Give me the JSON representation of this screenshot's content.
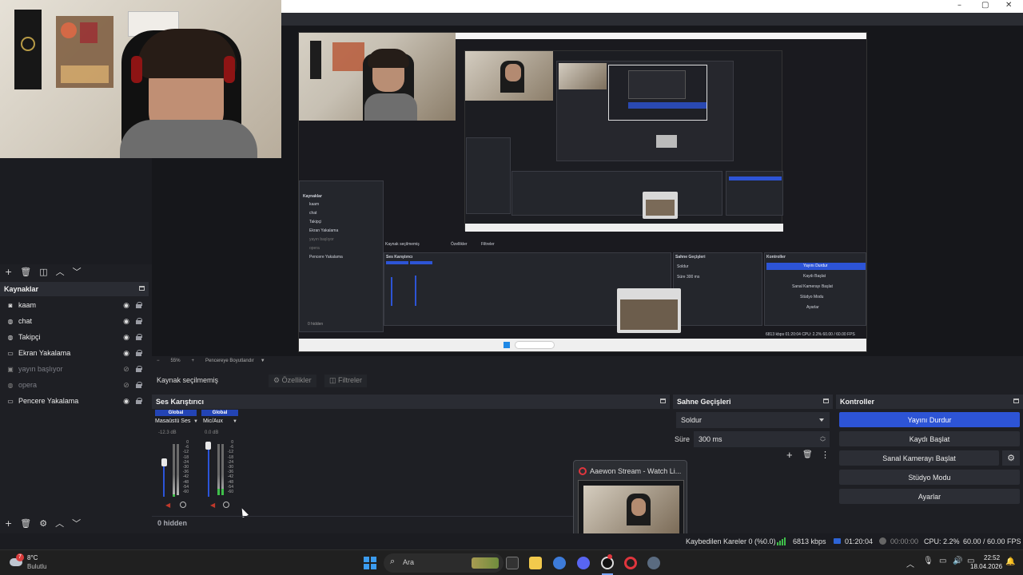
{
  "sources": {
    "title": "Kaynaklar",
    "items": [
      {
        "label": "kaam",
        "icon": "camera-icon",
        "visible": true
      },
      {
        "label": "chat",
        "icon": "globe-icon",
        "visible": true
      },
      {
        "label": "Takipçi",
        "icon": "globe-icon",
        "visible": true
      },
      {
        "label": "Ekran Yakalama",
        "icon": "monitor-icon",
        "visible": true
      },
      {
        "label": "yayın başlıyor",
        "icon": "image-icon",
        "visible": false
      },
      {
        "label": "opera",
        "icon": "globe-icon",
        "visible": false
      },
      {
        "label": "Pencere Yakalama",
        "icon": "window-icon",
        "visible": true
      }
    ]
  },
  "preview_toolbar": {
    "zoom_minus": "−",
    "zoom": "55%",
    "zoom_plus": "+",
    "fit": "Pencereye Boyutlandır"
  },
  "source_bar": {
    "no_selection": "Kaynak seçilmemiş",
    "properties": "Özellikler",
    "filters": "Filtreler"
  },
  "mixer": {
    "title": "Ses Karıştırıcı",
    "channels": [
      {
        "tag": "Global",
        "name": "Masaüstü Ses",
        "db": "-12.3 dB",
        "level": 0.42
      },
      {
        "tag": "Global",
        "name": "Mic/Aux",
        "db": "0.0 dB",
        "level": 0.9
      }
    ],
    "scale": [
      "0",
      "-6",
      "-12",
      "-18",
      "-24",
      "-30",
      "-36",
      "-42",
      "-48",
      "-54",
      "-60"
    ],
    "hidden": "0 hidden"
  },
  "transitions": {
    "title": "Sahne Geçişleri",
    "selected": "Soldur",
    "duration_label": "Süre",
    "duration_value": "300 ms"
  },
  "controls": {
    "title": "Kontroller",
    "stop_stream": "Yayını Durdur",
    "start_recording": "Kaydı Başlat",
    "start_virtualcam": "Sanal Kamerayı Başlat",
    "studio_mode": "Stüdyo Modu",
    "settings": "Ayarlar"
  },
  "popup": {
    "title": "Aaewon Stream - Watch Li..."
  },
  "status": {
    "dropped": "Kaybedilen Kareler 0 (%0.0)",
    "bitrate": "6813 kbps",
    "live_time": "01:20:04",
    "rec_time": "00:00:00",
    "cpu": "CPU: 2.2%",
    "fps": "60.00 / 60.00 FPS"
  },
  "taskbar": {
    "weather_temp": "8°C",
    "weather_desc": "Bulutlu",
    "weather_badge": "7",
    "search": "Ara",
    "time": "22:52",
    "date": "18.04.2026"
  },
  "colors": {
    "accent": "#2d54d6",
    "panel": "#1e1f24",
    "header": "#2a2c33"
  }
}
